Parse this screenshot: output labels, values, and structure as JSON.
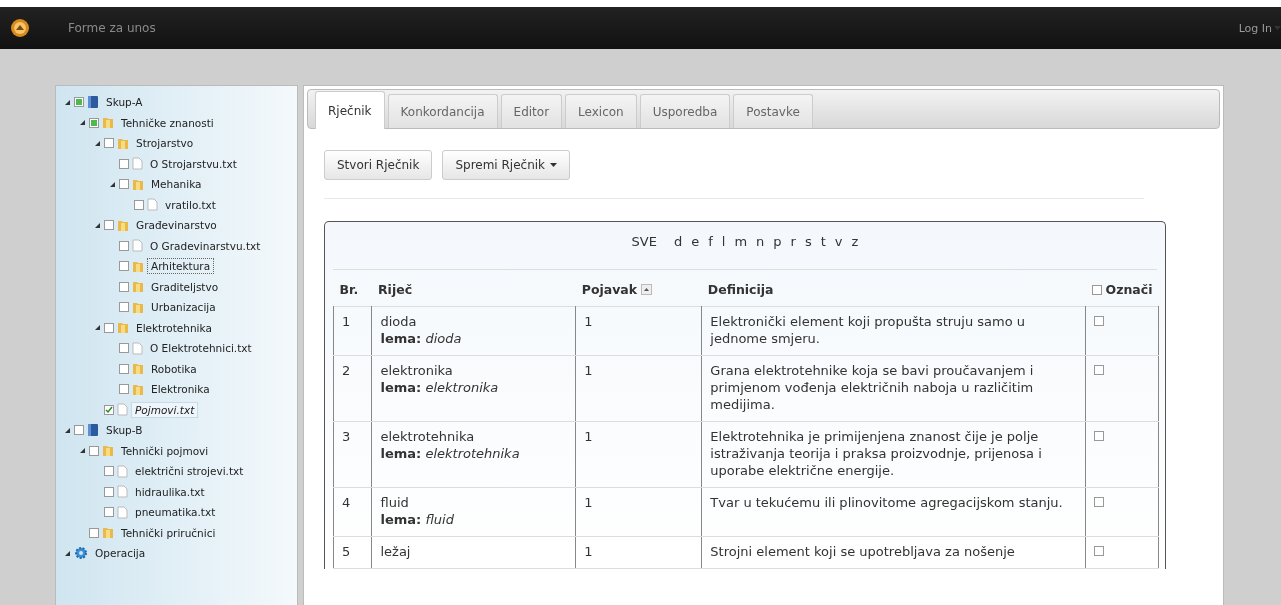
{
  "navbar": {
    "brand": "Forme za unos",
    "login": "Log In"
  },
  "tree": [
    {
      "label": "Skup-A",
      "kind": "set",
      "expanded": true,
      "checked": false,
      "partial": true,
      "selected": false,
      "focused": false,
      "children": [
        {
          "label": "Tehničke znanosti",
          "kind": "folder",
          "expanded": true,
          "checked": false,
          "partial": true,
          "selected": false,
          "focused": false,
          "children": [
            {
              "label": "Strojarstvo",
              "kind": "folder",
              "expanded": true,
              "checked": false,
              "selected": false,
              "focused": false,
              "children": [
                {
                  "label": "O Strojarstvu.txt",
                  "kind": "file",
                  "checked": false,
                  "selected": false,
                  "focused": false
                },
                {
                  "label": "Mehanika",
                  "kind": "folder",
                  "expanded": true,
                  "checked": false,
                  "selected": false,
                  "focused": false,
                  "children": [
                    {
                      "label": "vratilo.txt",
                      "kind": "file",
                      "checked": false,
                      "selected": false,
                      "focused": false
                    }
                  ]
                }
              ]
            },
            {
              "label": "Građevinarstvo",
              "kind": "folder",
              "expanded": true,
              "checked": false,
              "selected": false,
              "focused": false,
              "children": [
                {
                  "label": "O Gradevinarstvu.txt",
                  "kind": "file",
                  "checked": false,
                  "selected": false,
                  "focused": false
                },
                {
                  "label": "Arhitektura",
                  "kind": "folder",
                  "checked": false,
                  "selected": false,
                  "focused": true
                },
                {
                  "label": "Graditeljstvo",
                  "kind": "folder",
                  "checked": false,
                  "selected": false,
                  "focused": false
                },
                {
                  "label": "Urbanizacija",
                  "kind": "folder",
                  "checked": false,
                  "selected": false,
                  "focused": false
                }
              ]
            },
            {
              "label": "Elektrotehnika",
              "kind": "folder",
              "expanded": true,
              "checked": false,
              "selected": false,
              "focused": false,
              "children": [
                {
                  "label": "O Elektrotehnici.txt",
                  "kind": "file",
                  "checked": false,
                  "selected": false,
                  "focused": false
                },
                {
                  "label": "Robotika",
                  "kind": "folder",
                  "checked": false,
                  "selected": false,
                  "focused": false
                },
                {
                  "label": "Elektronika",
                  "kind": "folder",
                  "checked": false,
                  "selected": false,
                  "focused": false
                }
              ]
            },
            {
              "label": "Pojmovi.txt",
              "kind": "file",
              "checked": true,
              "selected": true,
              "focused": false
            }
          ]
        }
      ]
    },
    {
      "label": "Skup-B",
      "kind": "set",
      "expanded": true,
      "checked": false,
      "selected": false,
      "focused": false,
      "children": [
        {
          "label": "Tehnički pojmovi",
          "kind": "folder",
          "expanded": true,
          "checked": false,
          "selected": false,
          "focused": false,
          "children": [
            {
              "label": "električni strojevi.txt",
              "kind": "file",
              "checked": false,
              "selected": false,
              "focused": false
            },
            {
              "label": "hidraulika.txt",
              "kind": "file",
              "checked": false,
              "selected": false,
              "focused": false
            },
            {
              "label": "pneumatika.txt",
              "kind": "file",
              "checked": false,
              "selected": false,
              "focused": false
            }
          ]
        },
        {
          "label": "Tehnički priručnici",
          "kind": "folder",
          "checked": false,
          "selected": false,
          "focused": false
        }
      ]
    },
    {
      "label": "Operacija",
      "kind": "operations",
      "expanded": true,
      "selected": false,
      "focused": false
    }
  ],
  "tabs": [
    {
      "label": "Rječnik",
      "selected": true
    },
    {
      "label": "Konkordancija",
      "selected": false
    },
    {
      "label": "Editor",
      "selected": false
    },
    {
      "label": "Lexicon",
      "selected": false
    },
    {
      "label": "Usporedba",
      "selected": false
    },
    {
      "label": "Postavke",
      "selected": false
    }
  ],
  "buttons": [
    {
      "label": "Stvori Rječnik",
      "dropdown": false
    },
    {
      "label": "Spremi Rječnik",
      "dropdown": true
    }
  ],
  "letters": {
    "all": "SVE",
    "items": [
      "d",
      "e",
      "f",
      "l",
      "m",
      "n",
      "p",
      "r",
      "s",
      "t",
      "v",
      "z"
    ]
  },
  "table": {
    "columns": [
      {
        "label": "Br."
      },
      {
        "label": "Riječ"
      },
      {
        "label": "Pojavak",
        "sortable": true
      },
      {
        "label": "Definicija"
      }
    ],
    "mark_column": {
      "label": "Označi",
      "checked": false
    },
    "rows": [
      {
        "no": "1",
        "word": "dioda",
        "lemma": "**lema:** *dioda*",
        "count": "1",
        "definition": "Elektronički element koji propušta struju samo u jednome smjeru.",
        "checked": false
      },
      {
        "no": "2",
        "word": "elektronika",
        "lemma": "**lema:** *elektronika*",
        "count": "1",
        "definition": "Grana elektrotehnike koja se bavi proučavanjem i primjenom vođenja električnih naboja u različitim medijima.",
        "checked": false
      },
      {
        "no": "3",
        "word": "elektrotehnika",
        "lemma": "**lema:** *elektrotehnika*",
        "count": "1",
        "definition": "Elektrotehnika je primijenjena znanost čije je polje istraživanja teorija i praksa proizvodnje, prijenosa i uporabe električne energije.",
        "checked": false
      },
      {
        "no": "4",
        "word": "fluid",
        "lemma": "**lema:** *fluid*",
        "count": "1",
        "definition": "Tvar u tekućemu ili plinovitome agregacijskom stanju.",
        "checked": false
      },
      {
        "no": "5",
        "word": "ležaj",
        "count": "1",
        "definition": "Strojni element koji se upotrebljava za nošenje",
        "checked": false
      }
    ]
  }
}
